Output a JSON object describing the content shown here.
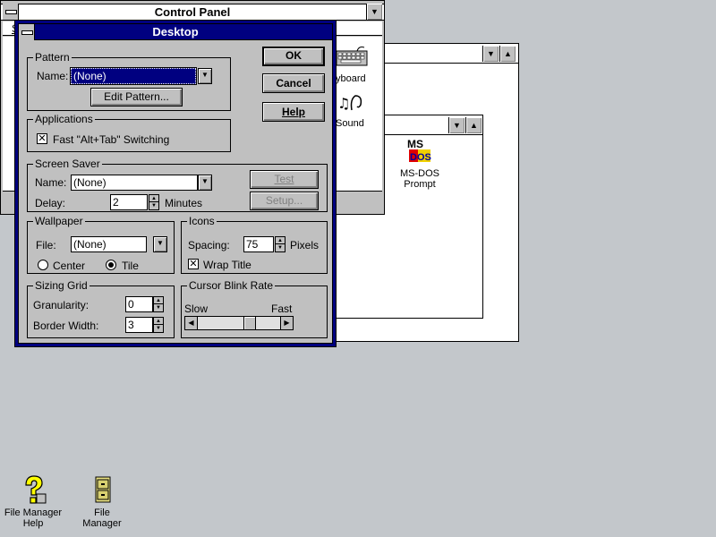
{
  "control_panel": {
    "title": "Control Panel",
    "menu_partial": "S",
    "icons": [
      {
        "label": "Keyboard",
        "visible_label": "yboard",
        "icon": "keyboard-icon"
      },
      {
        "label": "Sound",
        "visible_label": "Sound",
        "icon": "sound-icon"
      }
    ]
  },
  "group_window": {
    "item": {
      "label_line1": "MS-DOS",
      "label_line2": "Prompt",
      "icon": "ms-dos-icon"
    }
  },
  "desktop_dialog": {
    "title": "Desktop",
    "buttons": {
      "ok": "OK",
      "cancel": "Cancel",
      "help": "Help"
    },
    "pattern": {
      "group_label": "Pattern",
      "name_label": "Name:",
      "name_value": "(None)",
      "edit_button": "Edit Pattern..."
    },
    "applications": {
      "group_label": "Applications",
      "fast_switching_label": "Fast \"Alt+Tab\" Switching",
      "fast_switching_checked": true
    },
    "screen_saver": {
      "group_label": "Screen Saver",
      "name_label": "Name:",
      "name_value": "(None)",
      "delay_label": "Delay:",
      "delay_value": "2",
      "delay_unit": "Minutes",
      "test_button": "Test",
      "setup_button": "Setup..."
    },
    "wallpaper": {
      "group_label": "Wallpaper",
      "file_label": "File:",
      "file_value": "(None)",
      "center_label": "Center",
      "tile_label": "Tile",
      "selected": "tile"
    },
    "icons": {
      "group_label": "Icons",
      "spacing_label": "Spacing:",
      "spacing_value": "75",
      "spacing_unit": "Pixels",
      "wrap_title_label": "Wrap Title",
      "wrap_title_checked": true
    },
    "sizing_grid": {
      "group_label": "Sizing Grid",
      "granularity_label": "Granularity:",
      "granularity_value": "0",
      "border_width_label": "Border Width:",
      "border_width_value": "3"
    },
    "cursor_blink": {
      "group_label": "Cursor Blink Rate",
      "slow_label": "Slow",
      "fast_label": "Fast",
      "rate_fraction": 0.65
    }
  },
  "desktop_icons": [
    {
      "label_line1": "File Manager",
      "label_line2": "Help",
      "icon": "help-icon"
    },
    {
      "label_line1": "File Manager",
      "label_line2": "",
      "icon": "file-cabinet-icon"
    }
  ],
  "colors": {
    "desktop": "#c3c7cb",
    "active_title": "#000080",
    "face": "#c0c0c0"
  }
}
